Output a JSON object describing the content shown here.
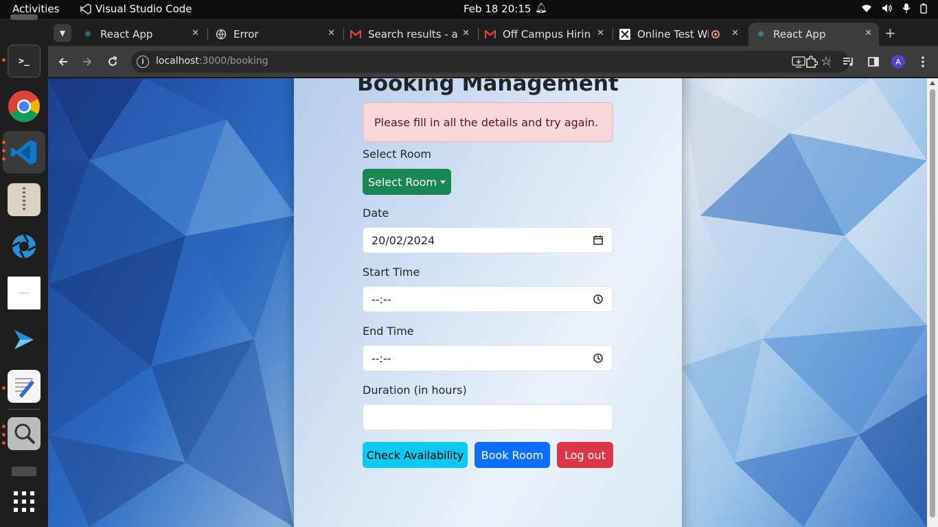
{
  "topbar": {
    "activities": "Activities",
    "app_name": "Visual Studio Code",
    "datetime": "Feb 18  20:15"
  },
  "tabs": [
    {
      "title": "React App",
      "favicon": "react-icon"
    },
    {
      "title": "Error",
      "favicon": "globe-icon"
    },
    {
      "title": "Search results - am",
      "favicon": "gmail-icon"
    },
    {
      "title": "Off Campus Hiring",
      "favicon": "gmail-icon"
    },
    {
      "title": "Online Test Wi",
      "favicon": "hackerrank-icon"
    },
    {
      "title": "React App",
      "favicon": "react-icon",
      "active": true
    }
  ],
  "address": {
    "host": "localhost",
    "rest": ":3000/booking"
  },
  "profile_initial": "A",
  "page": {
    "heading": "Booking Management",
    "alert": "Please fill in all the details and try again.",
    "select_room_label": "Select Room",
    "select_room_button": "Select Room",
    "date_label": "Date",
    "date_value": "20/02/2024",
    "start_time_label": "Start Time",
    "start_time_value": "--:--",
    "end_time_label": "End Time",
    "end_time_value": "--:--",
    "duration_label": "Duration (in hours)",
    "duration_value": "",
    "check_button": "Check Availability",
    "book_button": "Book Room",
    "logout_button": "Log out"
  },
  "colors": {
    "success": "#198754",
    "info": "#0dcaf0",
    "primary": "#0d6efd",
    "danger": "#dc3545",
    "alert_bg": "#f8d7da"
  }
}
